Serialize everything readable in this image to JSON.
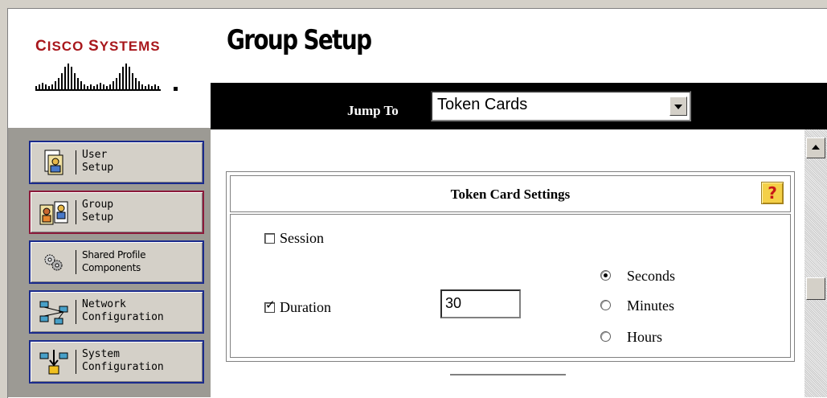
{
  "brand": {
    "name": "Cisco Systems",
    "color": "#a8171c"
  },
  "page": {
    "title": "Group Setup"
  },
  "jump": {
    "label": "Jump To",
    "selected": "Token Cards"
  },
  "nav": {
    "items": [
      {
        "label": "User\nSetup",
        "icon": "user-setup-icon",
        "active": false
      },
      {
        "label": "Group\nSetup",
        "icon": "group-setup-icon",
        "active": true
      },
      {
        "label": "Shared Profile\nComponents",
        "icon": "shared-profile-icon",
        "active": false
      },
      {
        "label": "Network\nConfiguration",
        "icon": "network-config-icon",
        "active": false
      },
      {
        "label": "System\nConfiguration",
        "icon": "system-config-icon",
        "active": false
      }
    ]
  },
  "panel": {
    "title": "Token Card Settings",
    "help_icon": "?",
    "session": {
      "label": "Session",
      "checked": false
    },
    "duration": {
      "label": "Duration",
      "checked": true,
      "value": "30"
    },
    "units": [
      {
        "label": "Seconds",
        "selected": true
      },
      {
        "label": "Minutes",
        "selected": false
      },
      {
        "label": "Hours",
        "selected": false
      }
    ]
  },
  "colors": {
    "nav_border": "#1a2a8c",
    "active_border": "#8c1a3a",
    "help_bg": "#f4d048"
  }
}
